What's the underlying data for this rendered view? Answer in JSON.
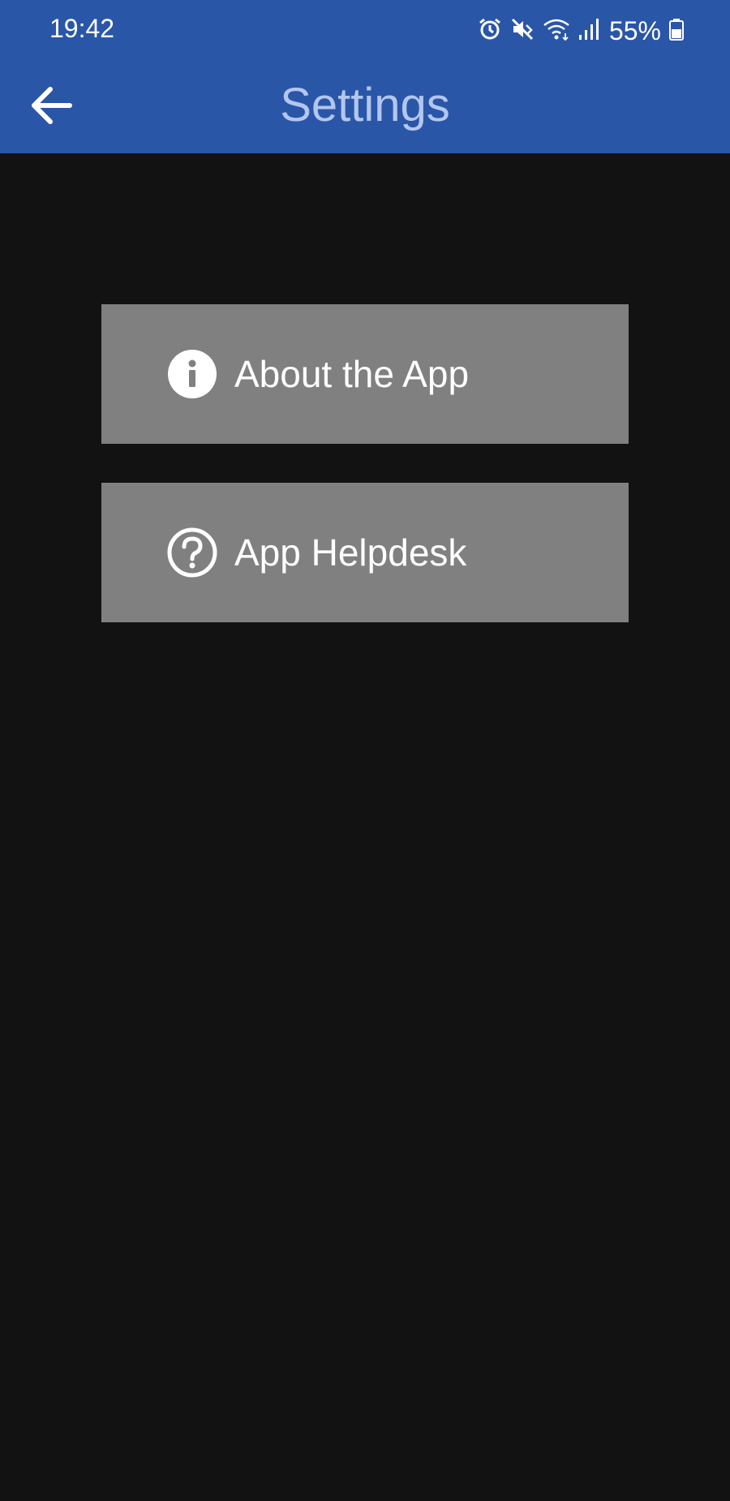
{
  "status_bar": {
    "time": "19:42",
    "battery_percent": "55%",
    "icons": [
      "alarm-icon",
      "mute-icon",
      "wifi-icon",
      "signal-icon",
      "battery-icon"
    ]
  },
  "app_bar": {
    "title": "Settings",
    "back_icon": "arrow-left-icon"
  },
  "menu": {
    "items": [
      {
        "label": "About the App",
        "icon": "info-icon"
      },
      {
        "label": "App Helpdesk",
        "icon": "help-icon"
      }
    ]
  },
  "colors": {
    "header_bg": "#2a56a8",
    "title_text": "#b3c6ee",
    "page_bg": "#121212",
    "button_bg": "#808080",
    "button_text": "#ffffff"
  }
}
